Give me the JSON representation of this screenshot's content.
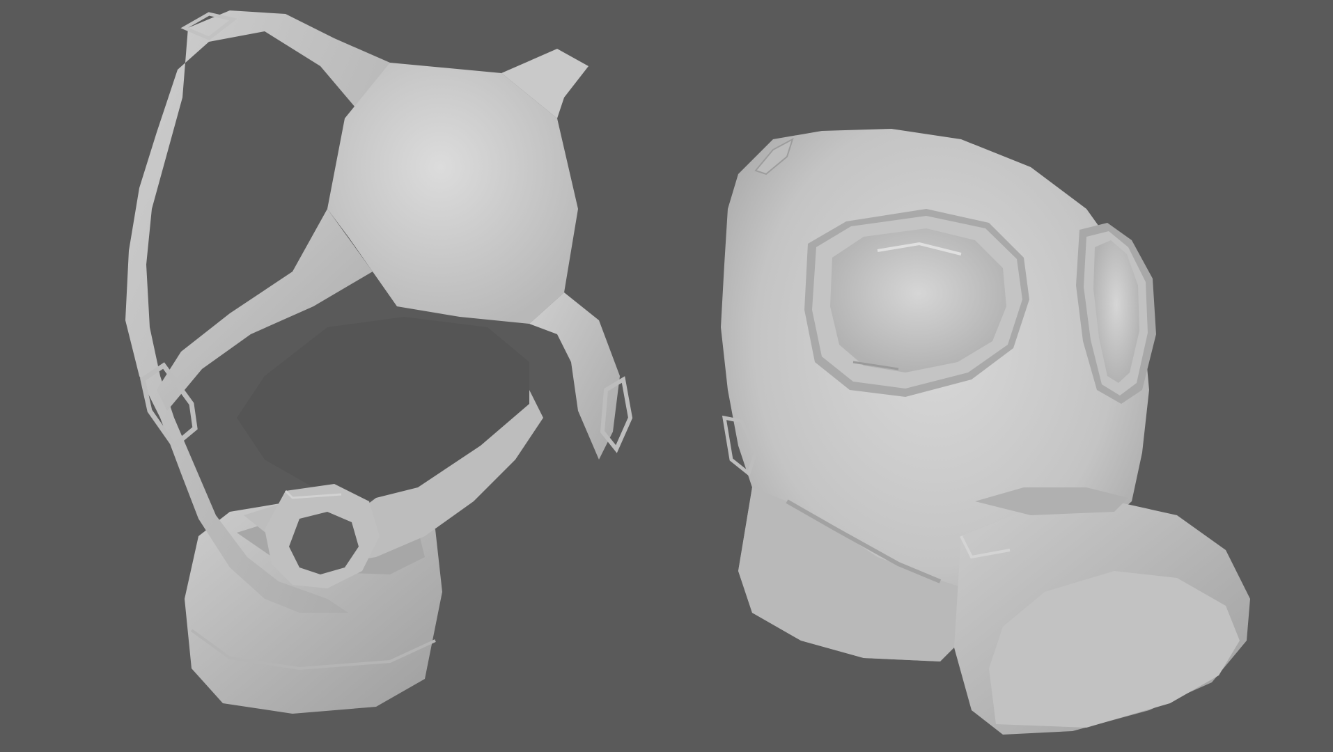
{
  "scene": {
    "background_color": "#5a5a5a",
    "model_color": "#c8c8c8",
    "models": [
      {
        "id": "gas-mask-back-view"
      },
      {
        "id": "gas-mask-front-view"
      }
    ]
  }
}
